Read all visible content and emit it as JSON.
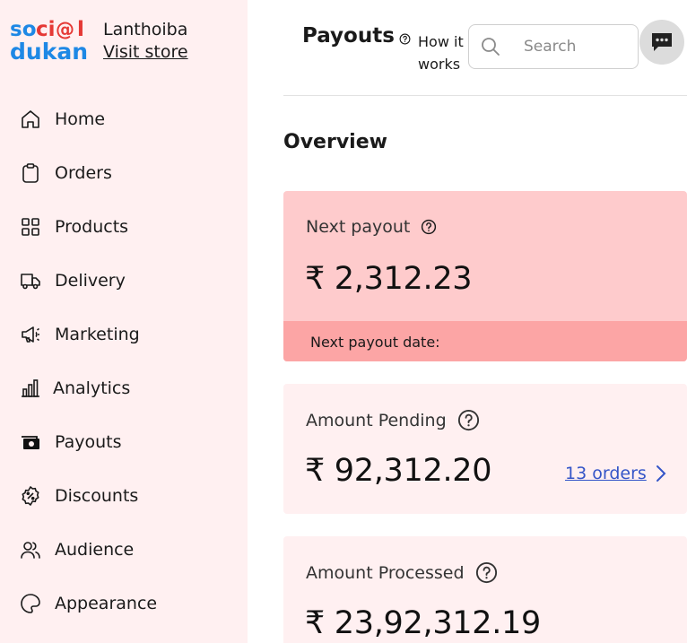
{
  "brand": {
    "logo_line1": "social",
    "logo_line2": "dukan",
    "store_name": "Lanthoiba",
    "visit_store": "Visit store"
  },
  "sidebar": {
    "items": [
      {
        "label": "Home",
        "icon": "home-icon"
      },
      {
        "label": "Orders",
        "icon": "clipboard-icon"
      },
      {
        "label": "Products",
        "icon": "grid-icon"
      },
      {
        "label": "Delivery",
        "icon": "truck-icon"
      },
      {
        "label": "Marketing",
        "icon": "megaphone-icon"
      },
      {
        "label": "Analytics",
        "icon": "bar-chart-icon"
      },
      {
        "label": "Payouts",
        "icon": "cash-icon"
      },
      {
        "label": "Discounts",
        "icon": "discount-badge-icon"
      },
      {
        "label": "Audience",
        "icon": "users-icon"
      },
      {
        "label": "Appearance",
        "icon": "palette-icon"
      }
    ]
  },
  "header": {
    "title": "Payouts",
    "how_it_works": "How it works",
    "search_placeholder": "Search"
  },
  "overview": {
    "heading": "Overview",
    "next_payout": {
      "label": "Next payout",
      "amount": "₹ 2,312.23",
      "date_label": "Next payout date:"
    },
    "pending": {
      "label": "Amount Pending",
      "amount": "₹ 92,312.20",
      "orders_link": "13 orders"
    },
    "processed": {
      "label": "Amount Processed",
      "amount": "₹ 23,92,312.19"
    }
  },
  "colors": {
    "sidebar_bg": "#fff0f1",
    "next_card_bg": "#fecbcc",
    "next_card_footer": "#fca5a5",
    "link": "#3455c8",
    "logo_blue": "#1e88e5",
    "logo_red": "#e53935"
  }
}
